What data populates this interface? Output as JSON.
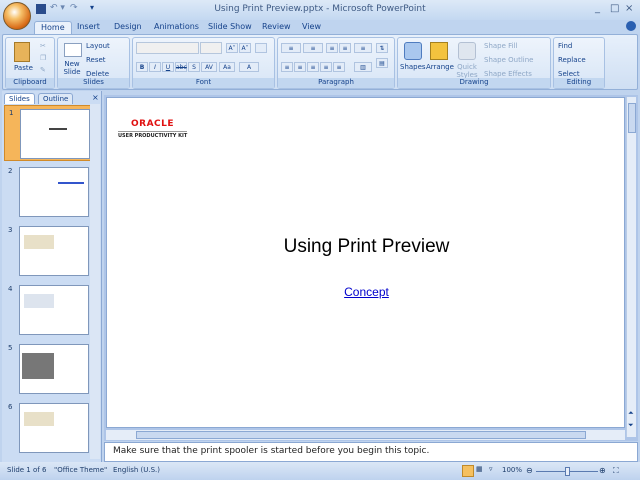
{
  "window": {
    "title": "Using Print Preview.pptx - Microsoft PowerPoint",
    "minimize": "_",
    "maximize": "□",
    "close": "×"
  },
  "tabs": [
    "Home",
    "Insert",
    "Design",
    "Animations",
    "Slide Show",
    "Review",
    "View"
  ],
  "ribbon": {
    "clipboard": {
      "label": "Clipboard",
      "paste": "Paste"
    },
    "slides": {
      "label": "Slides",
      "new_slide": "New Slide",
      "layout": "Layout",
      "reset": "Reset",
      "delete": "Delete"
    },
    "font": {
      "label": "Font",
      "bold": "B",
      "italic": "I",
      "underline": "U",
      "strike": "abc",
      "shadow": "S",
      "spacing": "AV",
      "case": "Aa",
      "color": "A",
      "grow": "A˄",
      "shrink": "A˅"
    },
    "paragraph": {
      "label": "Paragraph"
    },
    "drawing": {
      "label": "Drawing",
      "shapes": "Shapes",
      "arrange": "Arrange",
      "quick_styles": "Quick Styles",
      "shape_fill": "Shape Fill",
      "shape_outline": "Shape Outline",
      "shape_effects": "Shape Effects"
    },
    "editing": {
      "label": "Editing",
      "find": "Find",
      "replace": "Replace",
      "select": "Select"
    }
  },
  "panel": {
    "tabs": [
      "Slides",
      "Outline"
    ],
    "close": "×",
    "slides": [
      "1",
      "2",
      "3",
      "4",
      "5",
      "6"
    ],
    "selected": 1
  },
  "slide": {
    "logo": "ORACLE",
    "logo_sub": "USER PRODUCTIVITY KIT",
    "title": "Using Print Preview",
    "link": "Concept"
  },
  "notes": "Make sure that the print spooler is started before you begin this topic.",
  "status": {
    "slide": "Slide 1 of 6",
    "theme": "\"Office Theme\"",
    "language": "English (U.S.)",
    "zoom": "100%",
    "zoom_percent": 100
  }
}
